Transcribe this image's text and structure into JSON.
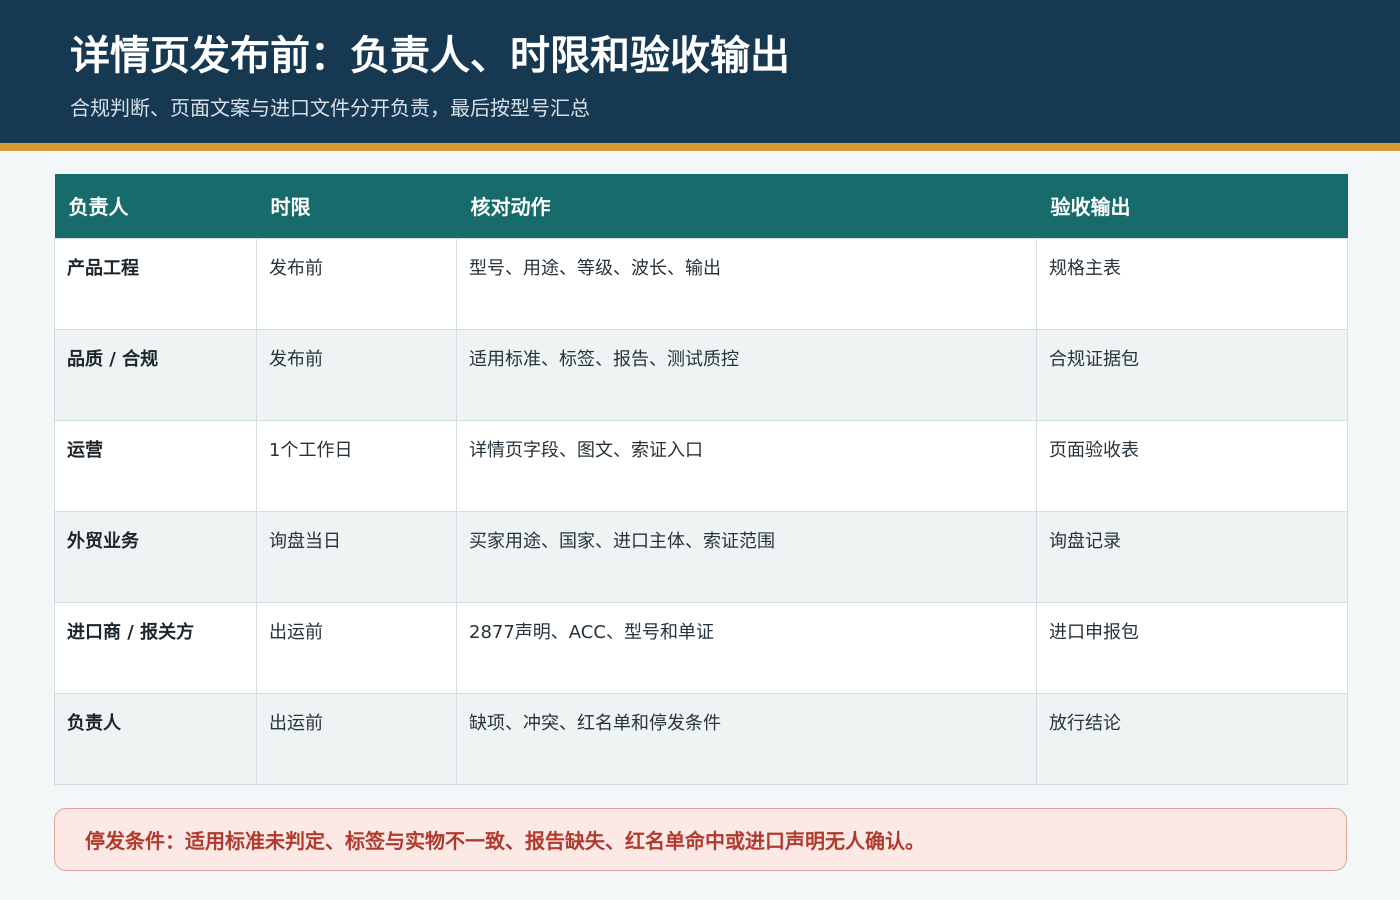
{
  "header": {
    "title": "详情页发布前：负责人、时限和验收输出",
    "subtitle": "合规判断、页面文案与进口文件分开负责，最后按型号汇总"
  },
  "table": {
    "columns": [
      "负责人",
      "时限",
      "核对动作",
      "验收输出"
    ],
    "rows": [
      {
        "owner": "产品工程",
        "deadline": "发布前",
        "action": "型号、用途、等级、波长、输出",
        "output": "规格主表"
      },
      {
        "owner": "品质 / 合规",
        "deadline": "发布前",
        "action": "适用标准、标签、报告、测试质控",
        "output": "合规证据包"
      },
      {
        "owner": "运营",
        "deadline": "1个工作日",
        "action": "详情页字段、图文、索证入口",
        "output": "页面验收表"
      },
      {
        "owner": "外贸业务",
        "deadline": "询盘当日",
        "action": "买家用途、国家、进口主体、索证范围",
        "output": "询盘记录"
      },
      {
        "owner": "进口商 / 报关方",
        "deadline": "出运前",
        "action": "2877声明、ACC、型号和单证",
        "output": "进口申报包"
      },
      {
        "owner": "负责人",
        "deadline": "出运前",
        "action": "缺项、冲突、红名单和停发条件",
        "output": "放行结论"
      }
    ]
  },
  "alert": {
    "text": "停发条件：适用标准未判定、标签与实物不一致、报告缺失、红名单命中或进口声明无人确认。"
  }
}
